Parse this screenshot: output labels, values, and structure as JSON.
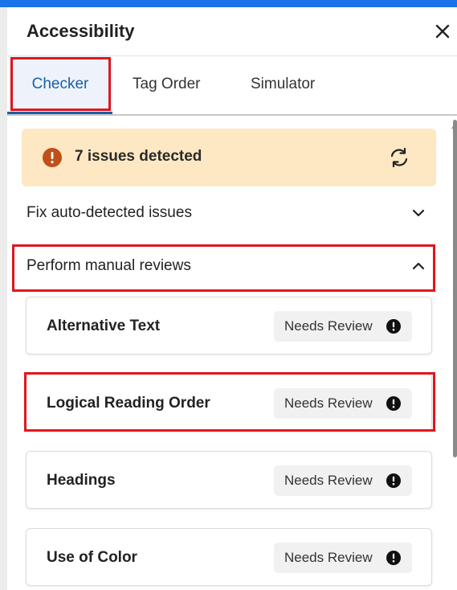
{
  "panel": {
    "title": "Accessibility",
    "close_icon": "close-icon"
  },
  "tabs": [
    {
      "label": "Checker",
      "active": true
    },
    {
      "label": "Tag Order",
      "active": false
    },
    {
      "label": "Simulator",
      "active": false
    }
  ],
  "banner": {
    "text": "7 issues detected",
    "icon": "alert-icon",
    "action_icon": "refresh-icon"
  },
  "sections": {
    "auto": {
      "label": "Fix auto-detected issues",
      "expanded": false
    },
    "manual": {
      "label": "Perform manual reviews",
      "expanded": true
    }
  },
  "review_items": [
    {
      "title": "Alternative Text",
      "status": "Needs Review"
    },
    {
      "title": "Logical Reading Order",
      "status": "Needs Review"
    },
    {
      "title": "Headings",
      "status": "Needs Review"
    },
    {
      "title": "Use of Color",
      "status": "Needs Review"
    }
  ],
  "colors": {
    "accent": "#1a73e8",
    "highlight": "#e0161f",
    "warning_bg": "#fde8c3",
    "warning_icon": "#c0501a"
  }
}
